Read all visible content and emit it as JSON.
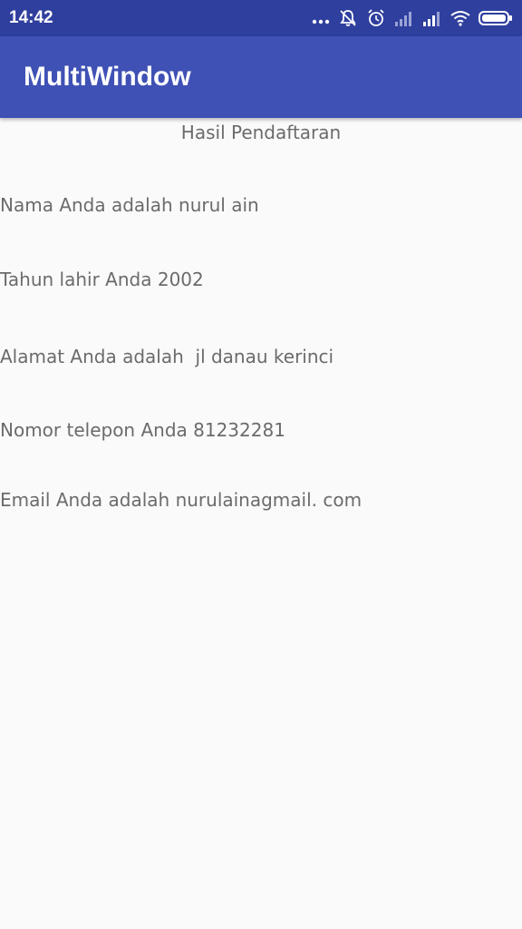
{
  "status_bar": {
    "time": "14:42",
    "icons": [
      "more-dots-icon",
      "mute-icon",
      "alarm-icon",
      "signal-icon",
      "signal-icon",
      "wifi-icon",
      "battery-icon"
    ]
  },
  "app_bar": {
    "title": "MultiWindow",
    "color": "#3f51b5"
  },
  "content": {
    "heading": "Hasil Pendaftaran",
    "lines": [
      "Nama Anda adalah nurul ain",
      "Tahun lahir Anda 2002",
      "Alamat Anda adalah  jl danau kerinci",
      "Nomor telepon Anda 81232281",
      "Email Anda adalah nurulainagmail. com"
    ]
  }
}
